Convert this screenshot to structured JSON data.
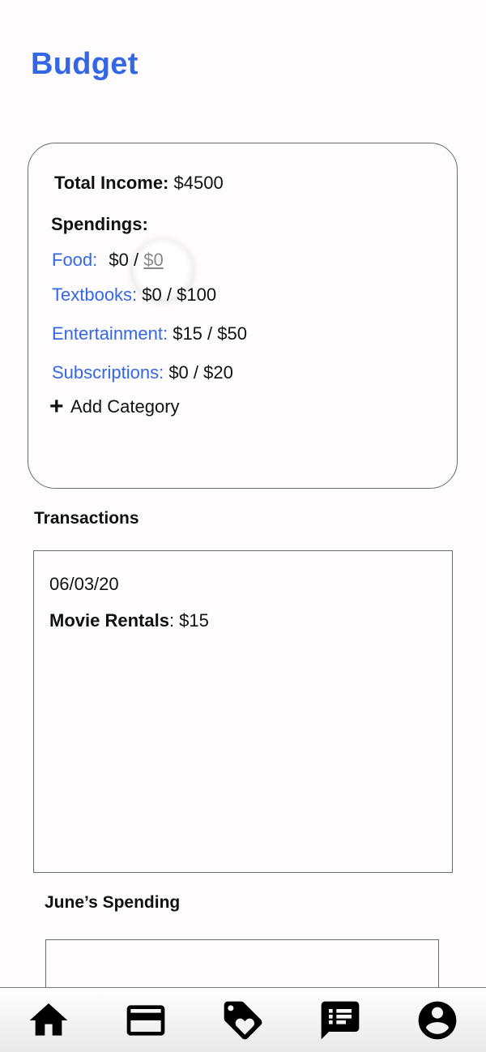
{
  "header": {
    "title": "Budget"
  },
  "budget": {
    "income_label": "Total Income:",
    "income_value": "$4500",
    "spendings_label": "Spendings:",
    "categories": [
      {
        "name": "Food:",
        "spent": "$0 /",
        "limit": "$0"
      },
      {
        "name": "Textbooks:",
        "spent": "$0 /",
        "limit": "$100"
      },
      {
        "name": "Entertainment:",
        "spent": "$15 /",
        "limit": "$50"
      },
      {
        "name": "Subscriptions:",
        "spent": "$0 /",
        "limit": "$20"
      }
    ],
    "add_category_label": "Add Category"
  },
  "transactions": {
    "title": "Transactions",
    "date": "06/03/20",
    "items": [
      {
        "name": "Movie Rentals",
        "amount": ": $15"
      }
    ]
  },
  "monthly": {
    "title": "June’s Spending"
  },
  "nav": {
    "items": [
      {
        "icon": "home-icon"
      },
      {
        "icon": "credit-card-icon"
      },
      {
        "icon": "tag-heart-icon"
      },
      {
        "icon": "chat-list-icon"
      },
      {
        "icon": "account-icon"
      }
    ]
  },
  "colors": {
    "accent": "#3467e6",
    "text": "#111111",
    "border": "#6a6a6a"
  }
}
